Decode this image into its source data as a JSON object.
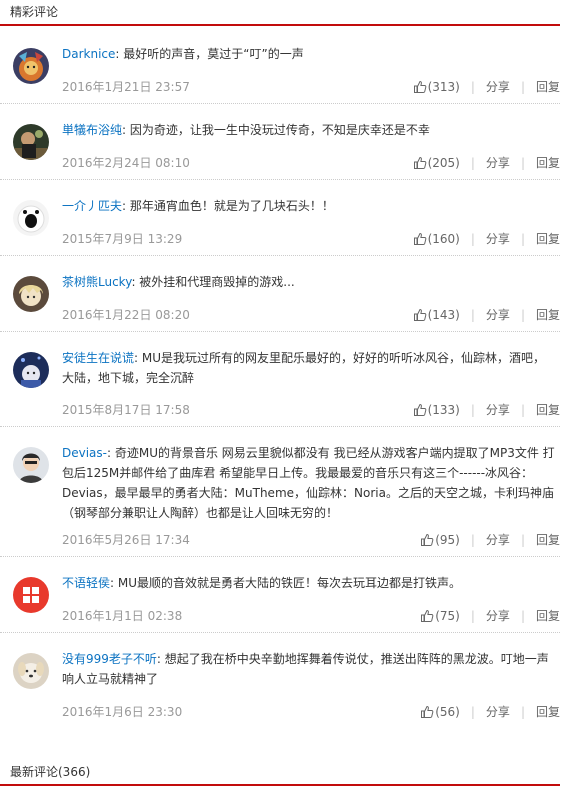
{
  "hot_title": "精彩评论",
  "latest_title": "最新评论(366)",
  "share_label": "分享",
  "reply_label": "回复",
  "comments": [
    {
      "user": "Darknice",
      "text": "最好听的声音，莫过于“叮”的一声",
      "time": "2016年1月21日 23:57",
      "likes": "(313)"
    },
    {
      "user": "単犠布浴纯",
      "text": "因为奇迹，让我一生中没玩过传奇，不知是庆幸还是不幸",
      "time": "2016年2月24日 08:10",
      "likes": "(205)"
    },
    {
      "user": "一介丿匹夫",
      "text": "那年通宵血色！就是为了几块石头！！",
      "time": "2015年7月9日 13:29",
      "likes": "(160)"
    },
    {
      "user": "茶树熊Lucky",
      "text": "被外挂和代理商毁掉的游戏...",
      "time": "2016年1月22日 08:20",
      "likes": "(143)"
    },
    {
      "user": "安徒生在说谎",
      "text": "MU是我玩过所有的网友里配乐最好的，好好的听听冰风谷，仙踪林，酒吧，大陆，地下城，完全沉醉",
      "time": "2015年8月17日 17:58",
      "likes": "(133)"
    },
    {
      "user": "Devias-",
      "text": "奇迹MU的背景音乐 网易云里貌似都没有 我已经从游戏客户端内提取了MP3文件 打包后125M并邮件给了曲库君 希望能早日上传。我最最爱的音乐只有这三个------冰风谷：Devias，最早最早的勇者大陆：MuTheme，仙踪林：Noria。之后的天空之城，卡利玛神庙（钢琴部分兼职让人陶醉）也都是让人回味无穷的！",
      "time": "2016年5月26日 17:34",
      "likes": "(95)"
    },
    {
      "user": "不语轻侯",
      "text": "MU最顺的音效就是勇者大陆的铁匠！每次去玩耳边都是打铁声。",
      "time": "2016年1月1日 02:38",
      "likes": "(75)"
    },
    {
      "user": "没有999老子不听",
      "text": "想起了我在桥中央辛勤地挥舞着传说仗，推送出阵阵的黑龙波。叮地一声响人立马就精神了",
      "time": "2016年1月6日 23:30",
      "likes": "(56)"
    }
  ]
}
